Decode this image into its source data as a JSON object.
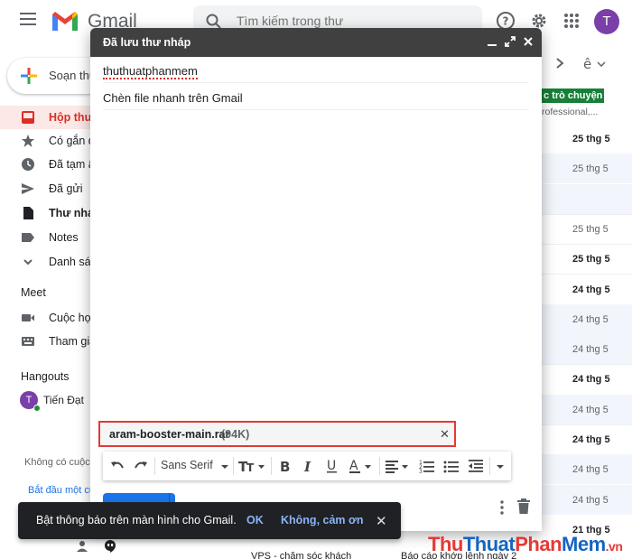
{
  "header": {
    "app_name": "Gmail",
    "search_placeholder": "Tìm kiếm trong thư",
    "avatar_letter": "T"
  },
  "sidebar": {
    "compose_label": "Soạn thư",
    "items": [
      {
        "label": "Hộp thư"
      },
      {
        "label": "Có gắn d"
      },
      {
        "label": "Đã tạm ẩ"
      },
      {
        "label": "Đã gửi"
      },
      {
        "label": "Thư nháp"
      },
      {
        "label": "Notes"
      },
      {
        "label": "Danh sác"
      }
    ],
    "meet_title": "Meet",
    "meet_items": [
      {
        "label": "Cuộc họp"
      },
      {
        "label": "Tham gia"
      }
    ],
    "hangouts_title": "Hangouts",
    "hangout_user": "Tiến Đạt",
    "hangout_avatar": "T",
    "no_contacts": "Không có cuộc",
    "start_link": "Bắt đầu một cu"
  },
  "email_list": {
    "badge": "c trò chuyện",
    "snippet": "rofessional,...",
    "dates": [
      {
        "text": "25 thg 5",
        "bold": true
      },
      {
        "text": "25 thg 5",
        "bold": false
      },
      {
        "text": "25 thg 5",
        "bold": false
      },
      {
        "text": "25 thg 5",
        "bold": true
      },
      {
        "text": "24 thg 5",
        "bold": true
      },
      {
        "text": "24 thg 5",
        "bold": false
      },
      {
        "text": "24 thg 5",
        "bold": false
      },
      {
        "text": "24 thg 5",
        "bold": true
      },
      {
        "text": "24 thg 5",
        "bold": false
      },
      {
        "text": "24 thg 5",
        "bold": true
      },
      {
        "text": "24 thg 5",
        "bold": false
      },
      {
        "text": "24 thg 5",
        "bold": false
      },
      {
        "text": "21 thg 5",
        "bold": true
      }
    ],
    "bottom_sender": "VPS - chăm sóc khách",
    "bottom_subject": "Báo cáo khớp lệnh ngày 2"
  },
  "compose": {
    "title": "Đã lưu thư nháp",
    "to": "thuthuatphanmem",
    "subject": "Chèn file nhanh trên Gmail",
    "attachment": {
      "name": "aram-booster-main.rar",
      "size": "(94K)"
    },
    "font_name": "Sans Serif"
  },
  "snackbar": {
    "message": "Bật thông báo trên màn hình cho Gmail.",
    "ok": "OK",
    "no": "Không, cảm ơn"
  },
  "watermark": {
    "part1": "Thu",
    "part2": "Thuat",
    "part3": "Phan",
    "part4": "Mem",
    "part5": ".vn"
  },
  "colors": {
    "accent": "#1a73e8",
    "compose_header": "#404040",
    "attachment_highlight": "#e53935",
    "active_item": "#d93025"
  }
}
